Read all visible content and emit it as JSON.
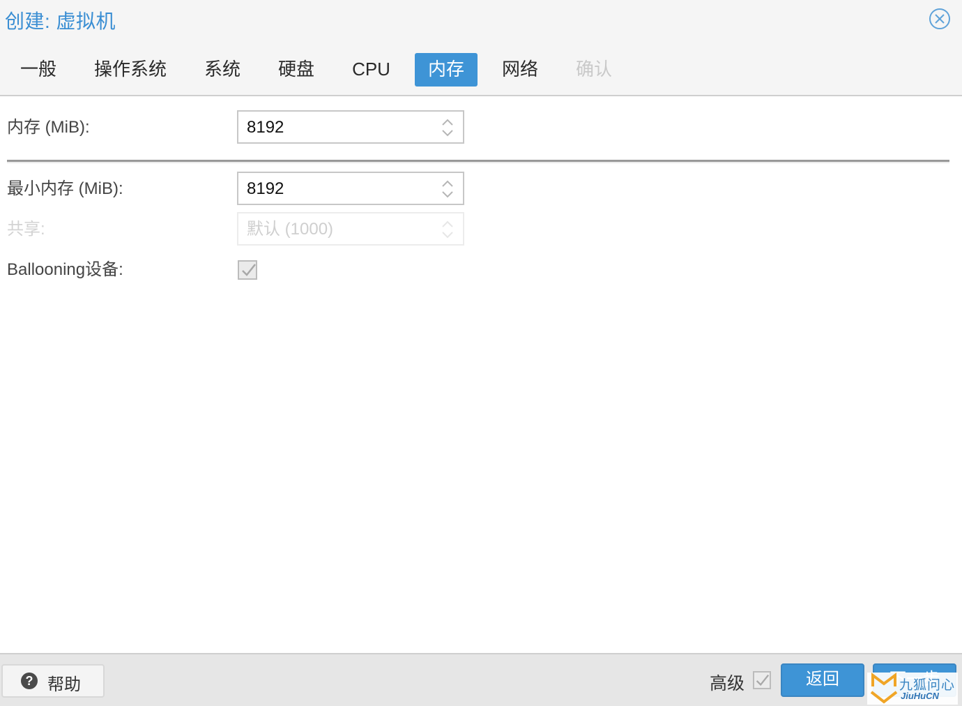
{
  "window": {
    "title": "创建: 虚拟机",
    "close_icon": "close-circle-icon"
  },
  "tabs": [
    {
      "label": "一般",
      "state": "normal"
    },
    {
      "label": "操作系统",
      "state": "normal"
    },
    {
      "label": "系统",
      "state": "normal"
    },
    {
      "label": "硬盘",
      "state": "normal"
    },
    {
      "label": "CPU",
      "state": "normal"
    },
    {
      "label": "内存",
      "state": "active"
    },
    {
      "label": "网络",
      "state": "normal"
    },
    {
      "label": "确认",
      "state": "disabled"
    }
  ],
  "form": {
    "memory": {
      "label": "内存 (MiB):",
      "value": "8192"
    },
    "min_memory": {
      "label": "最小内存 (MiB):",
      "value": "8192"
    },
    "shares": {
      "label": "共享:",
      "value": "",
      "placeholder": "默认 (1000)",
      "disabled": true
    },
    "ballooning": {
      "label": "Ballooning设备:",
      "checked": true
    }
  },
  "footer": {
    "help_label": "帮助",
    "help_icon": "question-circle-icon",
    "advanced_label": "高级",
    "advanced_checked": true,
    "back_label": "返回",
    "next_label": "下一步"
  },
  "watermark": {
    "text_cn": "九狐问心",
    "text_en": "JiuHuCN"
  },
  "colors": {
    "accent": "#3e94d6",
    "title": "#3a8ed3"
  }
}
